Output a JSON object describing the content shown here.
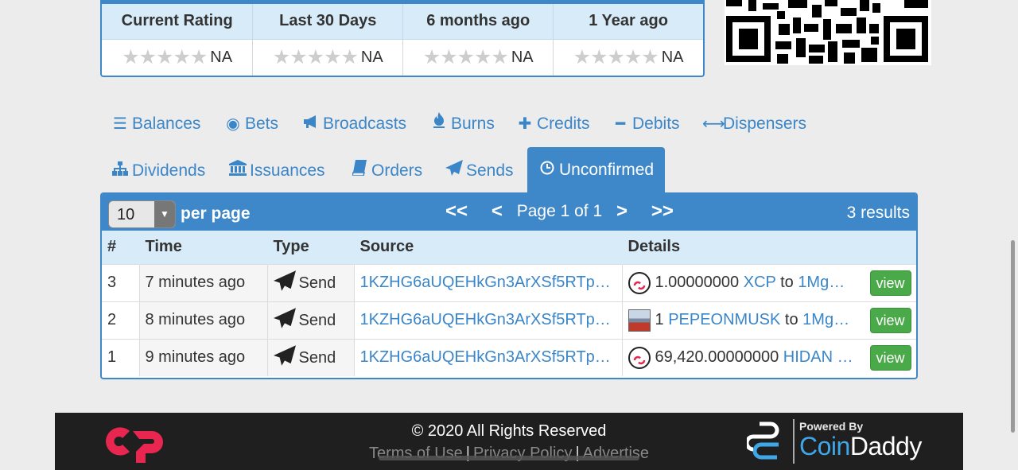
{
  "ratings": {
    "headers": [
      "Current Rating",
      "Last 30 Days",
      "6 months ago",
      "1 Year ago"
    ],
    "values": [
      "NA",
      "NA",
      "NA",
      "NA"
    ],
    "stars_filled": [
      0,
      0,
      0,
      0
    ]
  },
  "tabs": {
    "row1": [
      {
        "label": "Balances",
        "icon": "list-icon"
      },
      {
        "label": "Bets",
        "icon": "target-icon"
      },
      {
        "label": "Broadcasts",
        "icon": "megaphone-icon"
      },
      {
        "label": "Burns",
        "icon": "fire-icon"
      },
      {
        "label": "Credits",
        "icon": "plus-icon"
      },
      {
        "label": "Debits",
        "icon": "minus-icon"
      },
      {
        "label": "Dispensers",
        "icon": "arrows-horizontal-icon"
      }
    ],
    "row2": [
      {
        "label": "Dividends",
        "icon": "sitemap-icon"
      },
      {
        "label": "Issuances",
        "icon": "bank-icon"
      },
      {
        "label": "Orders",
        "icon": "book-icon"
      },
      {
        "label": "Sends",
        "icon": "paper-plane-icon"
      },
      {
        "label": "Unconfirmed",
        "icon": "clock-icon",
        "active": true
      }
    ]
  },
  "panel": {
    "per_page_value": "10",
    "per_page_label": "per page",
    "page_text": "Page 1 of 1",
    "first": "<<",
    "prev": "<",
    "next": ">",
    "last": ">>",
    "results_text": "3 results",
    "columns": [
      "#",
      "Time",
      "Type",
      "Source",
      "Details"
    ],
    "rows": [
      {
        "num": "3",
        "time": "7 minutes ago",
        "type": "Send",
        "source": "1KZHG6aUQEHkGn3ArXSf5RTp…",
        "amount": "1.00000000",
        "asset": "XCP",
        "to": "to",
        "dest": "1Mg…",
        "view": "view",
        "icon": "counterparty-icon"
      },
      {
        "num": "2",
        "time": "8 minutes ago",
        "type": "Send",
        "source": "1KZHG6aUQEHkGn3ArXSf5RTp…",
        "amount": "1",
        "asset": "PEPEONMUSK",
        "to": "to",
        "dest": "1Mg…",
        "view": "view",
        "icon": "asset-thumbnail"
      },
      {
        "num": "1",
        "time": "9 minutes ago",
        "type": "Send",
        "source": "1KZHG6aUQEHkGn3ArXSf5RTp…",
        "amount": "69,420.00000000",
        "asset": "HIDAN …",
        "to": "",
        "dest": "",
        "view": "view",
        "icon": "counterparty-icon"
      }
    ]
  },
  "footer": {
    "copyright": "© 2020 All Rights Reserved",
    "links": [
      "Terms of Use",
      "Privacy Policy",
      "Advertise"
    ],
    "powered_by": "Powered By",
    "brand_a": "Coin",
    "brand_b": "Daddy"
  },
  "colors": {
    "accent": "#3e88c9",
    "link": "#3a86c8",
    "view_button": "#4aaa4a",
    "counterparty_red": "#e8264f"
  }
}
